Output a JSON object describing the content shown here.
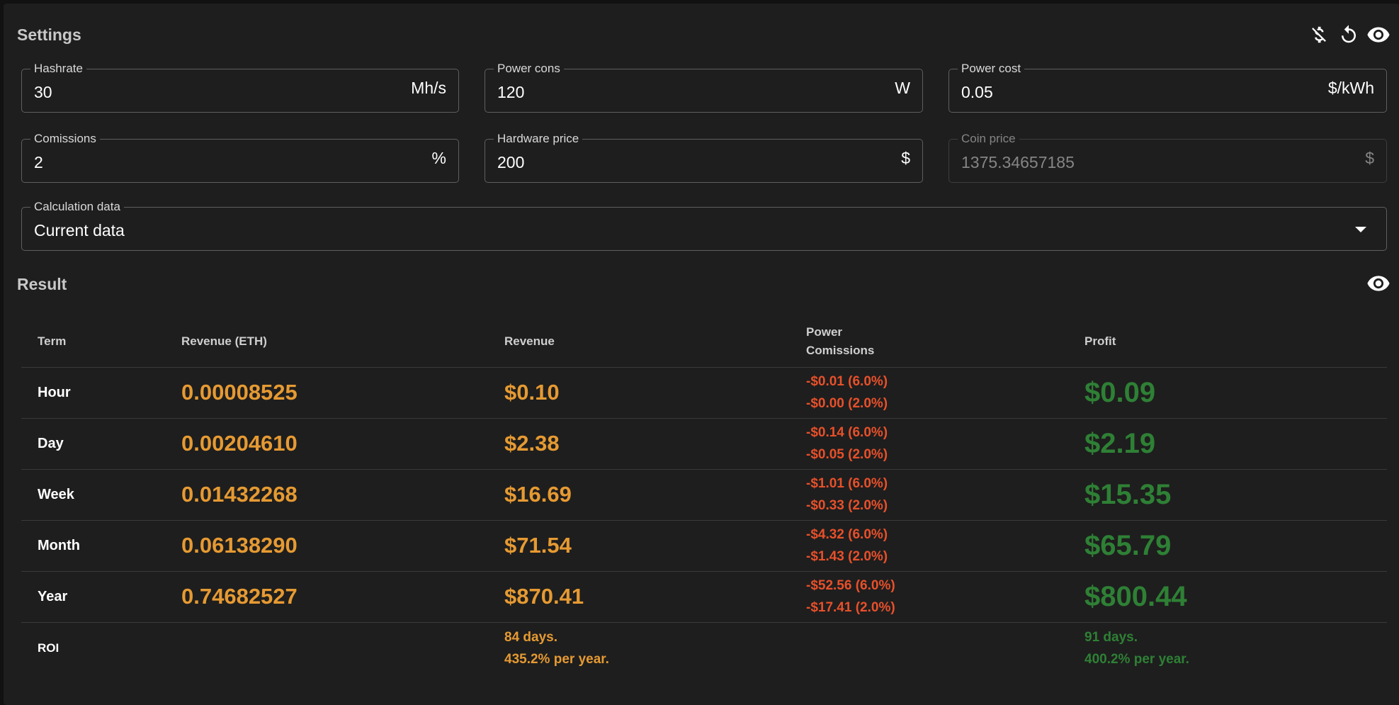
{
  "settings": {
    "title": "Settings",
    "icons": [
      "money-off-icon",
      "reset-icon",
      "visibility-icon"
    ],
    "fields": {
      "hashrate": {
        "label": "Hashrate",
        "value": "30",
        "unit": "Mh/s"
      },
      "power_cons": {
        "label": "Power cons",
        "value": "120",
        "unit": "W"
      },
      "power_cost": {
        "label": "Power cost",
        "value": "0.05",
        "unit": "$/kWh"
      },
      "comissions": {
        "label": "Comissions",
        "value": "2",
        "unit": "%"
      },
      "hardware_price": {
        "label": "Hardware price",
        "value": "200",
        "unit": "$"
      },
      "coin_price": {
        "label": "Coin price",
        "value": "1375.34657185",
        "unit": "$",
        "disabled": true
      },
      "calculation_data": {
        "label": "Calculation data",
        "value": "Current data"
      }
    }
  },
  "result": {
    "title": "Result",
    "headers": {
      "term": "Term",
      "revenue_eth": "Revenue (ETH)",
      "revenue": "Revenue",
      "power": "Power",
      "comissions": "Comissions",
      "profit": "Profit"
    },
    "rows": [
      {
        "term": "Hour",
        "revenue_eth": "0.00008525",
        "revenue": "$0.10",
        "power": "-$0.01 (6.0%)",
        "comissions": "-$0.00 (2.0%)",
        "profit": "$0.09"
      },
      {
        "term": "Day",
        "revenue_eth": "0.00204610",
        "revenue": "$2.38",
        "power": "-$0.14 (6.0%)",
        "comissions": "-$0.05 (2.0%)",
        "profit": "$2.19"
      },
      {
        "term": "Week",
        "revenue_eth": "0.01432268",
        "revenue": "$16.69",
        "power": "-$1.01 (6.0%)",
        "comissions": "-$0.33 (2.0%)",
        "profit": "$15.35"
      },
      {
        "term": "Month",
        "revenue_eth": "0.06138290",
        "revenue": "$71.54",
        "power": "-$4.32 (6.0%)",
        "comissions": "-$1.43 (2.0%)",
        "profit": "$65.79"
      },
      {
        "term": "Year",
        "revenue_eth": "0.74682527",
        "revenue": "$870.41",
        "power": "-$52.56 (6.0%)",
        "comissions": "-$17.41 (2.0%)",
        "profit": "$800.44"
      }
    ],
    "roi": {
      "label": "ROI",
      "revenue_days": "84 days.",
      "revenue_per_year": "435.2% per year.",
      "profit_days": "91 days.",
      "profit_per_year": "400.2% per year."
    }
  },
  "colors": {
    "background": "#1e1e1e",
    "revenue": "#e69a32",
    "cost": "#e8502a",
    "profit": "#2e8035"
  }
}
